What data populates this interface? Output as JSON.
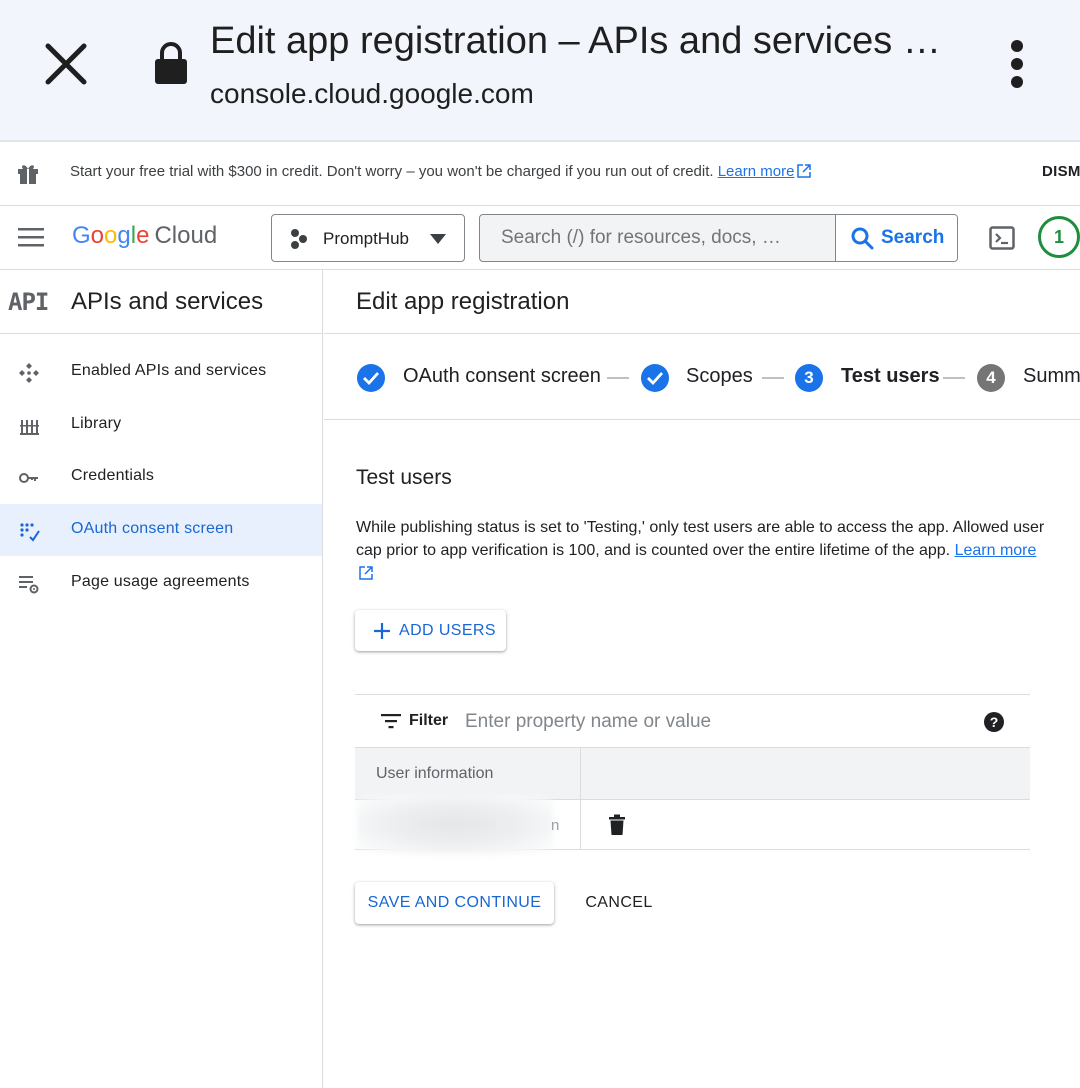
{
  "browser": {
    "title": "Edit app registration – APIs and services …",
    "url": "console.cloud.google.com",
    "icons": {
      "close": "close-icon",
      "lock": "lock-icon",
      "more": "more-vert-icon"
    }
  },
  "promo": {
    "text": "Start your free trial with $300 in credit. Don't worry – you won't be charged if you run out of credit.",
    "link_label": "Learn more",
    "dismiss_label": "DISM",
    "icon": "gift-icon"
  },
  "header": {
    "logo": {
      "google": "Google",
      "cloud": "Cloud"
    },
    "project_name": "PromptHub",
    "search_placeholder": "Search (/) for resources, docs, …",
    "search_button": "Search",
    "notification_count": "1"
  },
  "sidebar": {
    "api_badge": "API",
    "title": "APIs and services",
    "items": [
      {
        "label": "Enabled APIs and services",
        "icon": "enabled-apis-icon",
        "active": false
      },
      {
        "label": "Library",
        "icon": "library-icon",
        "active": false
      },
      {
        "label": "Credentials",
        "icon": "key-icon",
        "active": false
      },
      {
        "label": "OAuth consent screen",
        "icon": "oauth-icon",
        "active": true
      },
      {
        "label": "Page usage agreements",
        "icon": "settings-list-icon",
        "active": false
      }
    ]
  },
  "main": {
    "page_title": "Edit app registration",
    "steps": [
      {
        "label": "OAuth consent screen",
        "state": "done"
      },
      {
        "label": "Scopes",
        "state": "done"
      },
      {
        "number": "3",
        "label": "Test users",
        "state": "current"
      },
      {
        "number": "4",
        "label": "Summ",
        "state": "pending"
      }
    ],
    "section_title": "Test users",
    "section_desc": "While publishing status is set to 'Testing,' only test users are able to access the app. Allowed user cap prior to app verification is 100, and is counted over the entire lifetime of the app.",
    "learn_more": "Learn more",
    "add_users_label": "ADD USERS",
    "filter_label": "Filter",
    "filter_placeholder": "Enter property name or value",
    "table": {
      "columns": [
        "User information",
        ""
      ],
      "rows": [
        {
          "user_tail": "n"
        }
      ]
    },
    "save_label": "SAVE AND CONTINUE",
    "cancel_label": "CANCEL"
  },
  "colors": {
    "accent": "#1a73e8",
    "active_bg": "#e8f0fe",
    "step_done": "#1a73e8",
    "step_pending": "#757575",
    "notif_green": "#1e8e3e"
  }
}
